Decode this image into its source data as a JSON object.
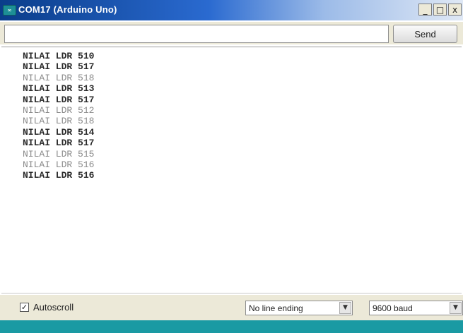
{
  "window": {
    "title": "COM17 (Arduino Uno)",
    "app_icon_glyph": "∞",
    "minimize_glyph": "_",
    "maximize_glyph": "□",
    "close_glyph": "x"
  },
  "send_bar": {
    "input_value": "",
    "send_label": "Send"
  },
  "output": {
    "lines": [
      {
        "text": "NILAI LDR 510",
        "faint": false
      },
      {
        "text": "NILAI LDR 517",
        "faint": false
      },
      {
        "text": "NILAI LDR 518",
        "faint": true
      },
      {
        "text": "NILAI LDR 513",
        "faint": false
      },
      {
        "text": "NILAI LDR 517",
        "faint": false
      },
      {
        "text": "NILAI LDR 512",
        "faint": true
      },
      {
        "text": "NILAI LDR 518",
        "faint": true
      },
      {
        "text": "NILAI LDR 514",
        "faint": false
      },
      {
        "text": "NILAI LDR 517",
        "faint": false
      },
      {
        "text": "NILAI LDR 515",
        "faint": true
      },
      {
        "text": "NILAI LDR 516",
        "faint": true
      },
      {
        "text": "NILAI LDR 516",
        "faint": false
      }
    ]
  },
  "footer": {
    "autoscroll_checked": true,
    "autoscroll_label": "Autoscroll",
    "checkmark_glyph": "✓",
    "line_ending_value": "No line ending",
    "baud_value": "9600 baud",
    "dropdown_glyph": "▼"
  },
  "colors": {
    "title_bar": "#0a3d8a",
    "chrome": "#ece9d8",
    "taskbar": "#1a9aa3"
  }
}
